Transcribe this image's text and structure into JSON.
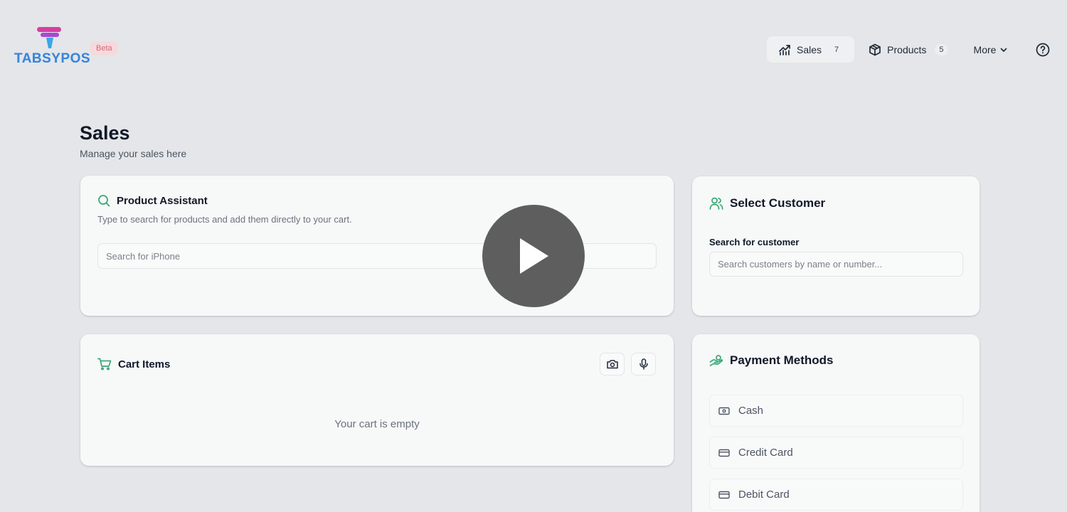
{
  "brand": {
    "name": "TABSYPOS",
    "badge": "Beta"
  },
  "nav": {
    "items": [
      {
        "label": "Sales",
        "count": "7",
        "icon": "chart-icon"
      },
      {
        "label": "Products",
        "count": "5",
        "icon": "box-icon"
      },
      {
        "label": "More",
        "icon": "chevron-down-icon"
      }
    ],
    "help_icon": "help-circle-icon"
  },
  "page": {
    "title": "Sales",
    "subtitle": "Manage your sales here"
  },
  "assistant": {
    "title": "Product Assistant",
    "description": "Type to search for products and add them directly to your cart.",
    "placeholder": "Search for iPhone"
  },
  "customer": {
    "title": "Select Customer",
    "label": "Search for customer",
    "placeholder": "Search customers by name or number..."
  },
  "cart": {
    "title": "Cart Items",
    "empty_text": "Your cart is empty"
  },
  "payments": {
    "title": "Payment Methods",
    "options": [
      {
        "label": "Cash"
      },
      {
        "label": "Credit Card"
      },
      {
        "label": "Debit Card"
      }
    ]
  },
  "colors": {
    "accent_green": "#3aa876",
    "brand_blue": "#3c86d9",
    "brand_pink": "#e0409a"
  }
}
